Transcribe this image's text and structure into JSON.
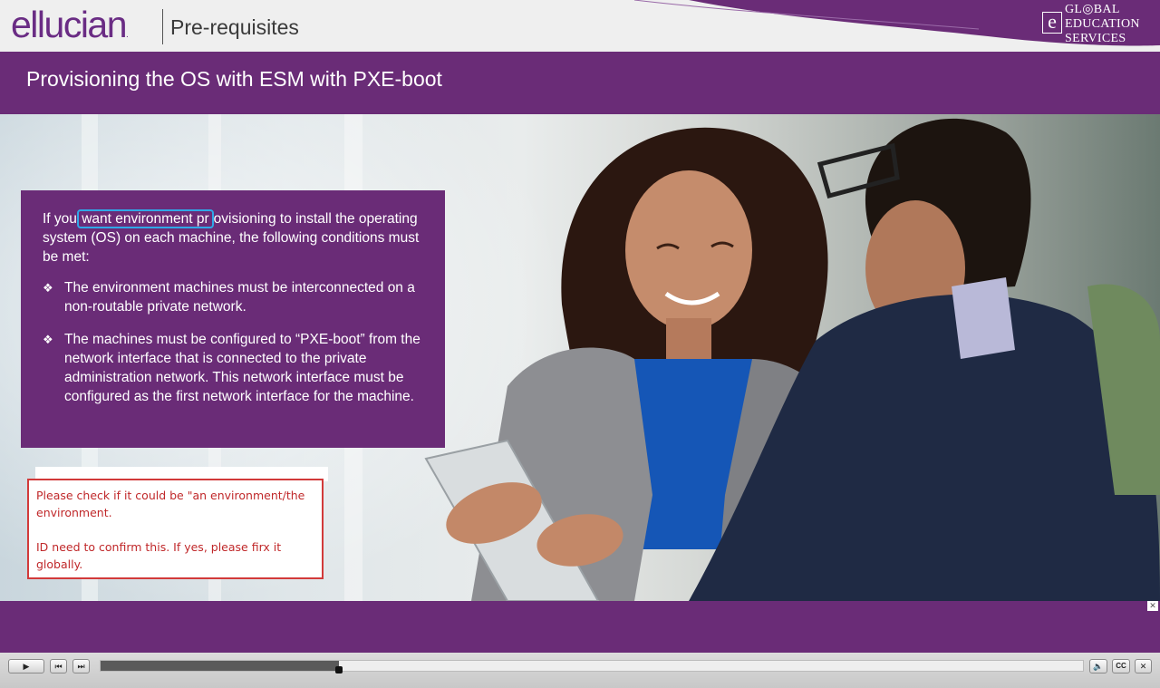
{
  "header": {
    "logo_text": "ellucian",
    "logo_mark": ".",
    "section_title": "Pre-requisites",
    "badge": {
      "letter": "e",
      "line1": "GL◎BAL",
      "line2": "EDUCATION",
      "line3": "SERVICES"
    }
  },
  "slide": {
    "title": "Provisioning the OS with ESM with PXE-boot",
    "intro_before": "If you",
    "intro_highlight": "want environment pr",
    "intro_after": "ovisioning to install the operating system (OS) on each machine, the following conditions must be met:",
    "bullets": [
      "The environment machines must be interconnected on a non-routable private network.",
      "The machines must be configured to “PXE-boot” from the network interface that is connected to the private administration network. This network interface must be configured as the first network interface for the machine."
    ],
    "bullet_mark": "❖"
  },
  "review_comment": {
    "text": " Please check if it could be \"an environment/the environment.\n\nID need to confirm this. If yes, please firx it globally."
  },
  "player": {
    "play_icon": "▶",
    "prev_icon": "⏮",
    "next_icon": "⏭",
    "volume_icon": "🔈",
    "cc_label": "CC",
    "close_label": "✕",
    "panel_close": "✕",
    "progress": 0.243
  },
  "colors": {
    "brand_purple": "#6a2c77",
    "highlight_blue": "#2fa8e8",
    "comment_red": "#c0282a"
  }
}
